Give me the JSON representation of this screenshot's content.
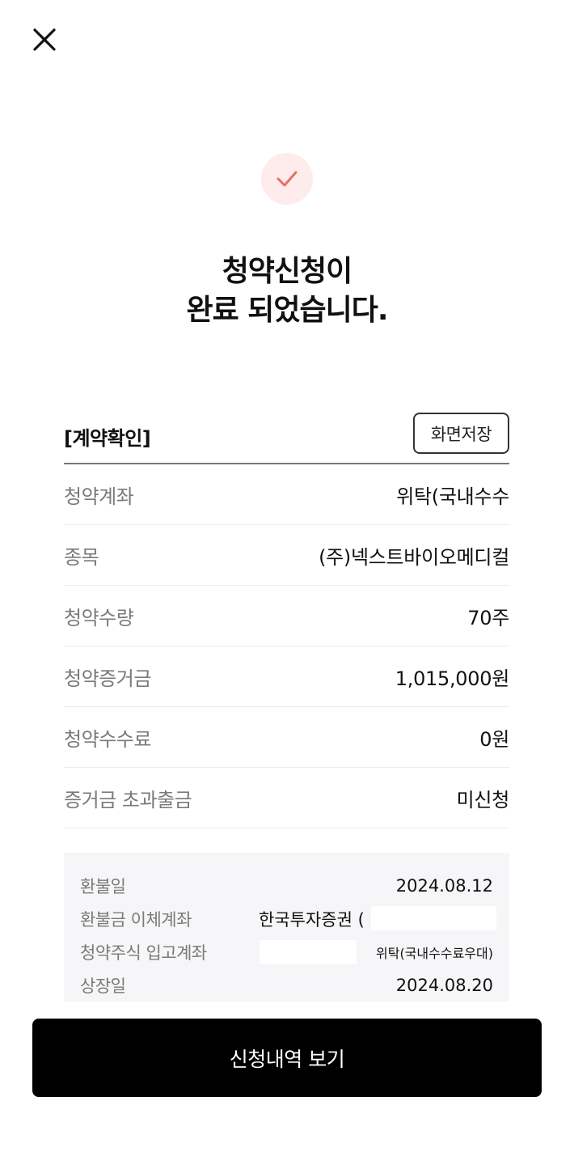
{
  "header": {
    "close_icon": "close-icon"
  },
  "status": {
    "icon": "check-icon",
    "icon_color": "#e8705f",
    "circle_color": "#fdeceb"
  },
  "title": {
    "line1": "청약신청이",
    "line2": "완료 되었습니다."
  },
  "contract": {
    "heading": "[계약확인]",
    "save_label": "화면저장",
    "rows": [
      {
        "label": "청약계좌",
        "value": "위탁(국내수수"
      },
      {
        "label": "종목",
        "value": "(주)넥스트바이오메디컬"
      },
      {
        "label": "청약수량",
        "value": "70주"
      },
      {
        "label": "청약증거금",
        "value": "1,015,000원"
      },
      {
        "label": "청약수수료",
        "value": "0원"
      },
      {
        "label": "증거금 초과출금",
        "value": "미신청"
      }
    ]
  },
  "info": {
    "refund_date_label": "환불일",
    "refund_date": "2024.08.12",
    "refund_account_label": "환불금 이체계좌",
    "refund_account": "한국투자증권 (",
    "stock_account_label": "청약주식 입고계좌",
    "stock_account": "위탁(국내수수료우대)",
    "listing_date_label": "상장일",
    "listing_date": "2024.08.20"
  },
  "footer": {
    "primary_label": "신청내역 보기"
  }
}
